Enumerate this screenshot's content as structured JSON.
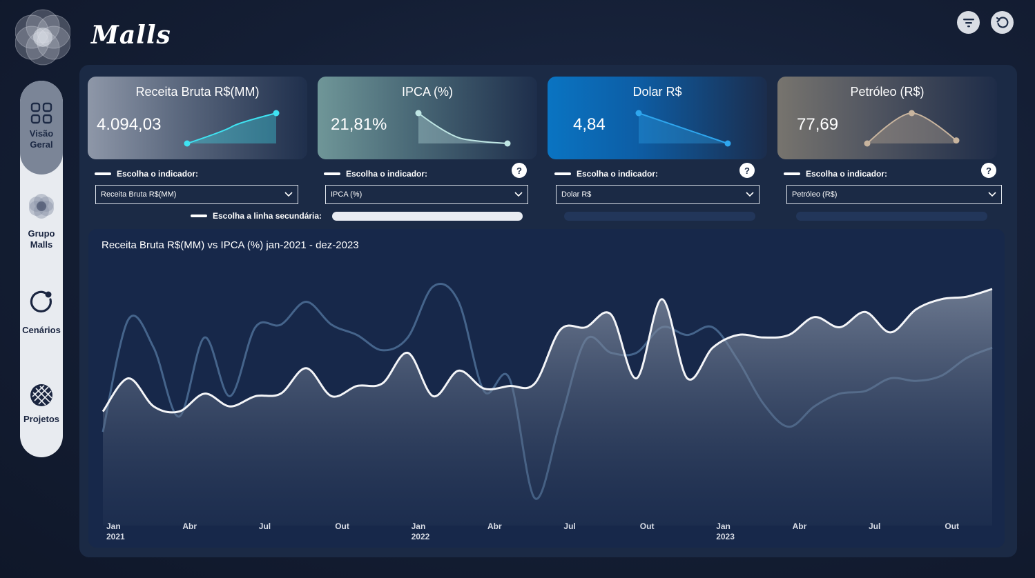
{
  "app": {
    "title": "Malls"
  },
  "sidebar": {
    "items": [
      {
        "label": "Visão Geral",
        "icon": "grid-icon",
        "active": true
      },
      {
        "label": "Grupo Malls",
        "icon": "mall-logo-icon"
      },
      {
        "label": "Cenários",
        "icon": "circle-refresh-icon"
      },
      {
        "label": "Projetos",
        "icon": "globe-grid-icon"
      }
    ]
  },
  "toolbar": {
    "filter_icon": "filter-icon",
    "reset_icon": "reset-icon"
  },
  "kpis": [
    {
      "title": "Receita Bruta R$(MM)",
      "value": "4.094,03",
      "color": "#3fe3f2",
      "trend": [
        0.0,
        0.55,
        1.0
      ]
    },
    {
      "title": "IPCA (%)",
      "value": "21,81%",
      "color": "#bfe6e4",
      "trend": [
        1.0,
        0.15,
        0.0
      ]
    },
    {
      "title": "Dolar R$",
      "value": "4,84",
      "color": "#2ea6ee",
      "trend": [
        1.0,
        0.5,
        0.0
      ]
    },
    {
      "title": "Petróleo (R$)",
      "value": "77,69",
      "color": "#c8b49e",
      "trend": [
        0.0,
        1.0,
        0.1
      ]
    }
  ],
  "selectors": {
    "label": "Escolha o indicador:",
    "help": "?",
    "values": [
      "Receita Bruta R$(MM)",
      "IPCA (%)",
      "Dolar R$",
      "Petróleo (R$)"
    ],
    "secondary_label": "Escolha a linha secundária:"
  },
  "chart": {
    "title": "Receita Bruta R$(MM) vs IPCA (%) jan-2021 - dez-2023",
    "chart_data": {
      "type": "line",
      "x": [
        "Jan 2021",
        "Fev 2021",
        "Mar 2021",
        "Abr 2021",
        "Mai 2021",
        "Jun 2021",
        "Jul 2021",
        "Ago 2021",
        "Set 2021",
        "Out 2021",
        "Nov 2021",
        "Dez 2021",
        "Jan 2022",
        "Fev 2022",
        "Mar 2022",
        "Abr 2022",
        "Mai 2022",
        "Jun 2022",
        "Jul 2022",
        "Ago 2022",
        "Set 2022",
        "Out 2022",
        "Nov 2022",
        "Dez 2022",
        "Jan 2023",
        "Fev 2023",
        "Mar 2023",
        "Abr 2023",
        "Mai 2023",
        "Jun 2023",
        "Jul 2023",
        "Ago 2023",
        "Set 2023",
        "Out 2023",
        "Nov 2023",
        "Dez 2023"
      ],
      "tick_labels": [
        {
          "i": 0,
          "month": "Jan",
          "year": "2021"
        },
        {
          "i": 3,
          "month": "Abr",
          "year": ""
        },
        {
          "i": 6,
          "month": "Jul",
          "year": ""
        },
        {
          "i": 9,
          "month": "Out",
          "year": ""
        },
        {
          "i": 12,
          "month": "Jan",
          "year": "2022"
        },
        {
          "i": 15,
          "month": "Abr",
          "year": ""
        },
        {
          "i": 18,
          "month": "Jul",
          "year": ""
        },
        {
          "i": 21,
          "month": "Out",
          "year": ""
        },
        {
          "i": 24,
          "month": "Jan",
          "year": "2023"
        },
        {
          "i": 27,
          "month": "Abr",
          "year": ""
        },
        {
          "i": 30,
          "month": "Jul",
          "year": ""
        },
        {
          "i": 33,
          "month": "Out",
          "year": ""
        }
      ],
      "series": [
        {
          "values": [
            0.42,
            0.55,
            0.44,
            0.42,
            0.49,
            0.44,
            0.48,
            0.49,
            0.59,
            0.48,
            0.52,
            0.53,
            0.65,
            0.48,
            0.58,
            0.51,
            0.52,
            0.53,
            0.74,
            0.75,
            0.8,
            0.55,
            0.86,
            0.55,
            0.67,
            0.72,
            0.71,
            0.72,
            0.79,
            0.75,
            0.81,
            0.73,
            0.82,
            0.86,
            0.87,
            0.9
          ],
          "color": "#f4f5f8",
          "area": true
        },
        {
          "values": [
            0.34,
            0.78,
            0.67,
            0.4,
            0.71,
            0.48,
            0.75,
            0.76,
            0.85,
            0.76,
            0.72,
            0.66,
            0.71,
            0.91,
            0.85,
            0.5,
            0.55,
            0.08,
            0.38,
            0.7,
            0.65,
            0.65,
            0.75,
            0.72,
            0.75,
            0.62,
            0.45,
            0.36,
            0.44,
            0.49,
            0.5,
            0.55,
            0.54,
            0.56,
            0.63,
            0.67
          ],
          "color": "#4a6a92",
          "area": false
        }
      ],
      "ylim": [
        0,
        1
      ]
    }
  }
}
